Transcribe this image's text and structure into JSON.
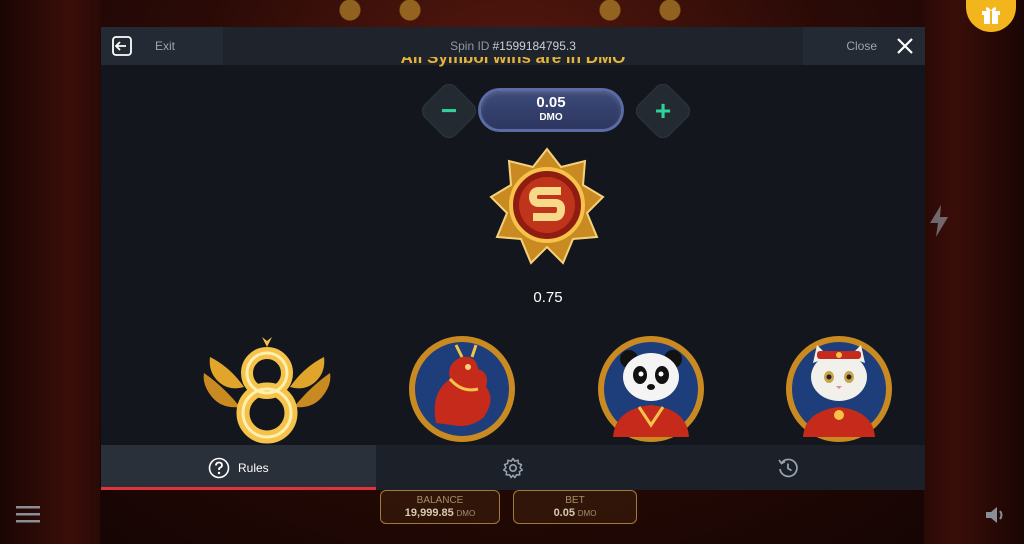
{
  "header": {
    "exit_label": "Exit",
    "spin_id_label": "Spin ID",
    "spin_id_value": "#1599184795.3",
    "close_label": "Close"
  },
  "rules": {
    "partial_heading": "All Symbol wins are in DMO"
  },
  "bet": {
    "amount": "0.05",
    "currency": "DMO"
  },
  "scatter": {
    "icon": "scatter-s-medallion-icon",
    "value": "0.75"
  },
  "symbols": [
    {
      "icon": "golden-winged-eight-icon"
    },
    {
      "icon": "red-dragon-icon"
    },
    {
      "icon": "panda-icon"
    },
    {
      "icon": "lucky-cat-icon"
    }
  ],
  "tabs": [
    {
      "label": "Rules",
      "icon": "question-circle-icon",
      "active": true
    },
    {
      "label": "",
      "icon": "gear-icon",
      "active": false
    },
    {
      "label": "",
      "icon": "history-clock-icon",
      "active": false
    }
  ],
  "background": {
    "balance_label": "BALANCE",
    "balance_value": "19,999.85",
    "balance_unit": "DMO",
    "bet_label": "BET",
    "bet_value": "0.05",
    "bet_unit": "DMO"
  },
  "colors": {
    "accent_green": "#2fd39a",
    "active_tab_underline": "#e0333b",
    "modal_bg": "#13171d",
    "gold": "#f2b51c"
  }
}
